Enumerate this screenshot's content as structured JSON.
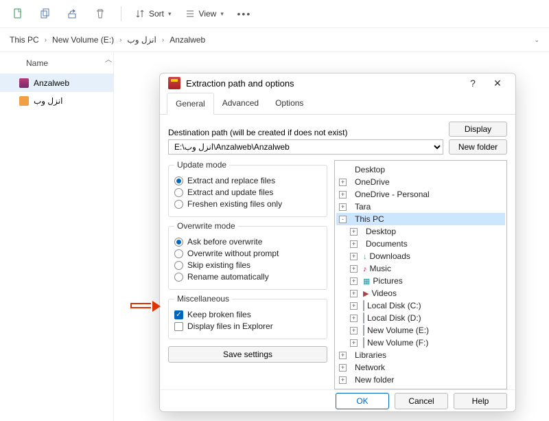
{
  "toolbar": {
    "sort_label": "Sort",
    "view_label": "View"
  },
  "breadcrumb": {
    "parts": [
      "This PC",
      "New Volume (E:)",
      "انزل وب",
      "Anzalweb"
    ]
  },
  "column_header": {
    "name": "Name"
  },
  "files": [
    {
      "name": "Anzalweb",
      "icon": "rar",
      "selected": true
    },
    {
      "name": "انزل وب",
      "icon": "pdf",
      "selected": false
    }
  ],
  "dialog": {
    "title": "Extraction path and options",
    "tabs": [
      "General",
      "Advanced",
      "Options"
    ],
    "active_tab": 0,
    "dest_label": "Destination path (will be created if does not exist)",
    "dest_value": "E:\\انزل وب\\Anzalweb\\Anzalweb",
    "display_btn": "Display",
    "newfolder_btn": "New folder",
    "update_mode": {
      "legend": "Update mode",
      "options": [
        "Extract and replace files",
        "Extract and update files",
        "Freshen existing files only"
      ],
      "selected": 0
    },
    "overwrite_mode": {
      "legend": "Overwrite mode",
      "options": [
        "Ask before overwrite",
        "Overwrite without prompt",
        "Skip existing files",
        "Rename automatically"
      ],
      "selected": 0
    },
    "misc": {
      "legend": "Miscellaneous",
      "keep_broken": {
        "label": "Keep broken files",
        "checked": true
      },
      "display_explorer": {
        "label": "Display files in Explorer",
        "checked": false
      }
    },
    "save_label": "Save settings",
    "tree": [
      {
        "depth": 0,
        "pm": "",
        "icon": "dsk",
        "label": "Desktop"
      },
      {
        "depth": 0,
        "pm": "+",
        "icon": "cld",
        "label": "OneDrive"
      },
      {
        "depth": 0,
        "pm": "+",
        "icon": "cld",
        "label": "OneDrive - Personal"
      },
      {
        "depth": 0,
        "pm": "+",
        "icon": "fld",
        "label": "Tara"
      },
      {
        "depth": 0,
        "pm": "-",
        "icon": "pc",
        "label": "This PC",
        "selected": true
      },
      {
        "depth": 1,
        "pm": "+",
        "icon": "dsk",
        "label": "Desktop"
      },
      {
        "depth": 1,
        "pm": "+",
        "icon": "fld",
        "label": "Documents"
      },
      {
        "depth": 1,
        "pm": "+",
        "icon": "dl",
        "label": "Downloads"
      },
      {
        "depth": 1,
        "pm": "+",
        "icon": "mus",
        "label": "Music"
      },
      {
        "depth": 1,
        "pm": "+",
        "icon": "pic",
        "label": "Pictures"
      },
      {
        "depth": 1,
        "pm": "+",
        "icon": "vid",
        "label": "Videos"
      },
      {
        "depth": 1,
        "pm": "+",
        "icon": "drv",
        "label": "Local Disk (C:)"
      },
      {
        "depth": 1,
        "pm": "+",
        "icon": "drv",
        "label": "Local Disk (D:)"
      },
      {
        "depth": 1,
        "pm": "+",
        "icon": "drv",
        "label": "New Volume (E:)"
      },
      {
        "depth": 1,
        "pm": "+",
        "icon": "drv",
        "label": "New Volume (F:)"
      },
      {
        "depth": 0,
        "pm": "+",
        "icon": "fld",
        "label": "Libraries"
      },
      {
        "depth": 0,
        "pm": "+",
        "icon": "fld",
        "label": "Network"
      },
      {
        "depth": 0,
        "pm": "+",
        "icon": "fld",
        "label": "New folder"
      }
    ],
    "ok": "OK",
    "cancel": "Cancel",
    "help": "Help"
  }
}
